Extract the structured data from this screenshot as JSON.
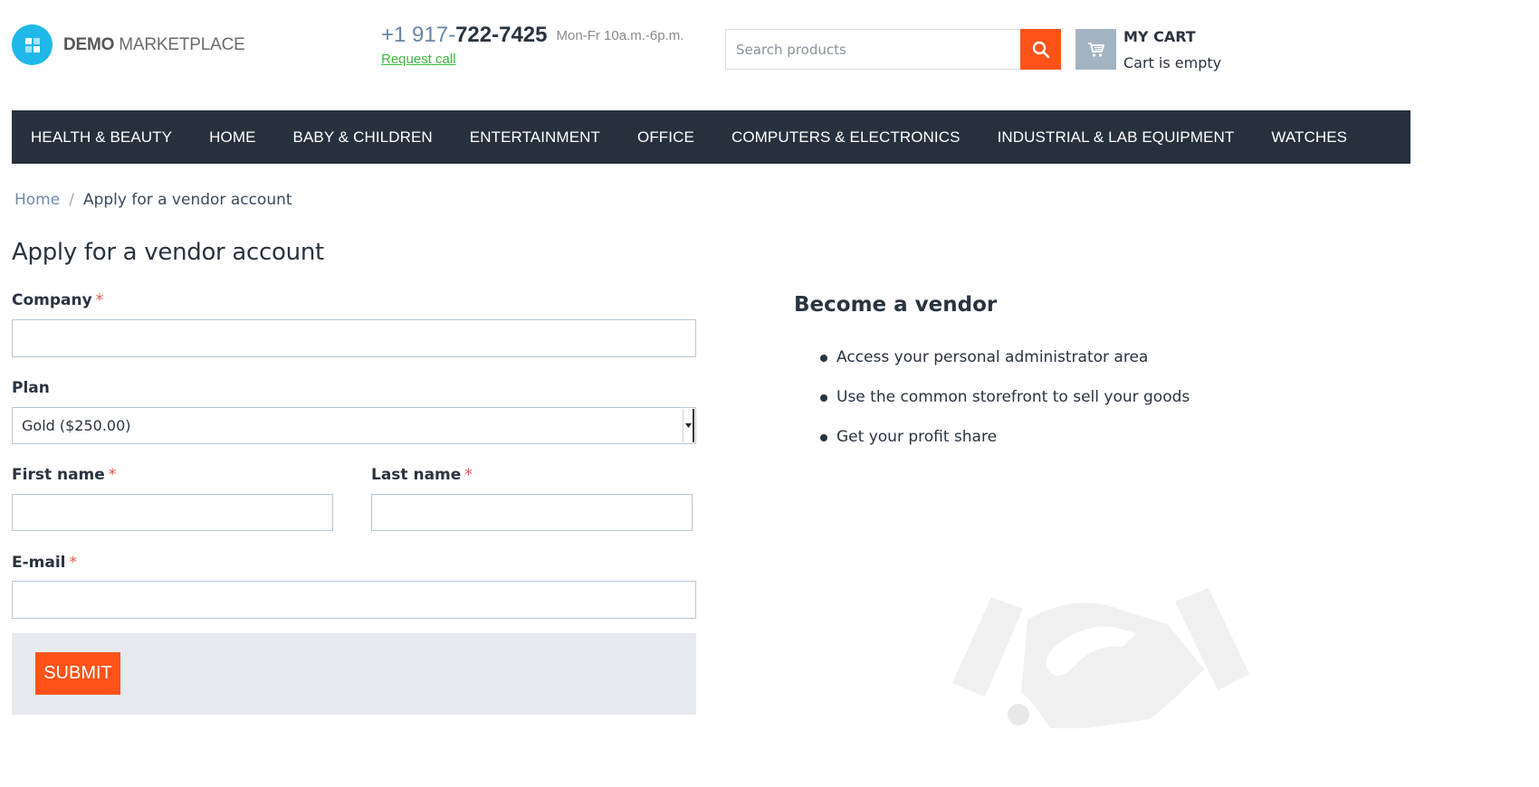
{
  "header": {
    "logo_bold": "DEMO",
    "logo_rest": " MARKETPLACE",
    "phone_prefix": "+1 917-",
    "phone_main": "722-7425",
    "hours": "Mon-Fr 10a.m.-6p.m.",
    "request_call": "Request call",
    "search_placeholder": "Search products",
    "cart_title": "MY CART",
    "cart_status": "Cart is empty"
  },
  "nav": {
    "items": [
      "HEALTH & BEAUTY",
      "HOME",
      "BABY & CHILDREN",
      "ENTERTAINMENT",
      "OFFICE",
      "COMPUTERS & ELECTRONICS",
      "INDUSTRIAL & LAB EQUIPMENT",
      "WATCHES"
    ]
  },
  "breadcrumb": {
    "home": "Home",
    "separator": "/",
    "current": "Apply for a vendor account"
  },
  "page_title": "Apply for a vendor account",
  "form": {
    "company_label": "Company",
    "plan_label": "Plan",
    "plan_value": "Gold ($250.00)",
    "first_name_label": "First name",
    "last_name_label": "Last name",
    "email_label": "E-mail",
    "required_mark": "*",
    "submit_label": "SUBMIT"
  },
  "vendor_info": {
    "title": "Become a vendor",
    "benefits": [
      "Access your personal administrator area",
      "Use the common storefront to sell your goods",
      "Get your profit share"
    ]
  },
  "colors": {
    "accent": "#ff5319",
    "nav_bg": "#27313e",
    "logo": "#20b8e8",
    "link_green": "#3bb83b",
    "cart_icon_bg": "#a3b3c2"
  },
  "icons": {
    "logo": "grid-squares-icon",
    "search": "search-icon",
    "cart": "cart-icon",
    "select": "chevron-down-icon",
    "decoration": "handshake-icon"
  }
}
